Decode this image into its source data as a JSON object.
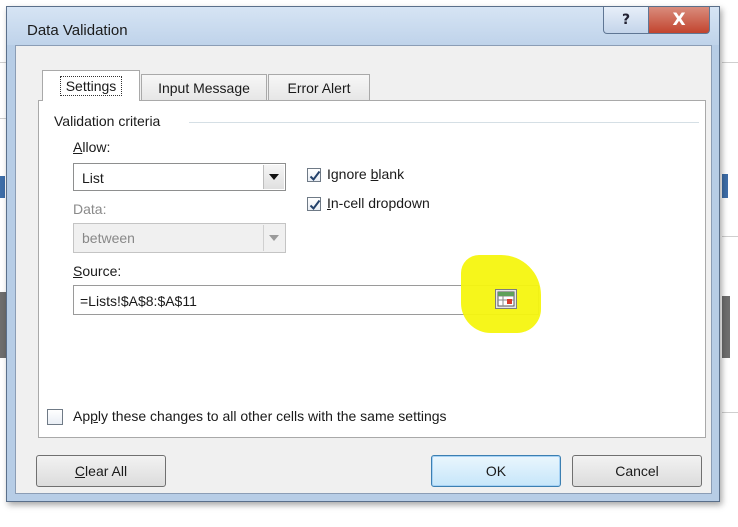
{
  "dialog": {
    "title": "Data Validation",
    "help_glyph": "?",
    "close_glyph": "X"
  },
  "tabs": [
    {
      "label": "Settings",
      "active": true
    },
    {
      "label": "Input Message",
      "active": false
    },
    {
      "label": "Error Alert",
      "active": false
    }
  ],
  "criteria": {
    "group_label": "Validation criteria",
    "allow_label_u": "A",
    "allow_label_rest": "llow:",
    "allow_value": "List",
    "data_label": "Data:",
    "data_value": "between",
    "ignore_blank_pre": "Ignore ",
    "ignore_blank_u": "b",
    "ignore_blank_post": "lank",
    "ignore_blank_checked": true,
    "incell_u": "I",
    "incell_rest": "n-cell dropdown",
    "incell_checked": true,
    "source_label_u": "S",
    "source_label_rest": "ource:",
    "source_value": "=Lists!$A$8:$A$11"
  },
  "apply_all": {
    "label_pre": "Ap",
    "label_u": "p",
    "label_post": "ly these changes to all other cells with the same settings",
    "checked": false
  },
  "buttons": {
    "clear_all_u": "C",
    "clear_all_rest": "lear All",
    "ok": "OK",
    "cancel": "Cancel"
  },
  "colors": {
    "highlight": "#f5f50f",
    "close_button": "#c2442e",
    "title_bar": "#bfd3ea"
  },
  "icons": {
    "reference": "range-select-icon",
    "check": "checkmark-icon"
  }
}
